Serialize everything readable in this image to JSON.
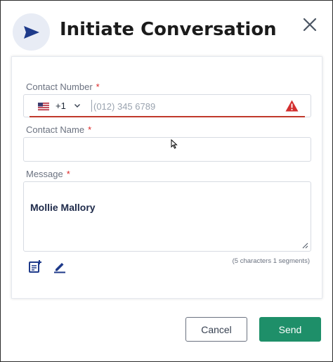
{
  "dialog": {
    "title": "Initiate Conversation",
    "header_icon": "send-icon",
    "close_icon": "close-icon"
  },
  "form": {
    "contact_number": {
      "label": "Contact Number",
      "required_mark": "*",
      "country_flag": "us-flag-icon",
      "dial_code": "+1",
      "placeholder": "(012) 345 6789",
      "value": "",
      "status_icon": "warning-icon"
    },
    "contact_name": {
      "label": "Contact Name",
      "required_mark": "*",
      "value": ""
    },
    "message": {
      "label": "Message",
      "required_mark": "*",
      "value": "Mollie Mallory",
      "counter": "(5 characters 1 segments)",
      "tools": [
        "add-template-icon",
        "edit-icon"
      ]
    }
  },
  "buttons": {
    "cancel": "Cancel",
    "send": "Send"
  },
  "colors": {
    "accent": "#1e8f69",
    "error": "#c0392b",
    "header_icon_bg": "#e8ecf5",
    "header_icon_fg": "#1e3a8a"
  }
}
